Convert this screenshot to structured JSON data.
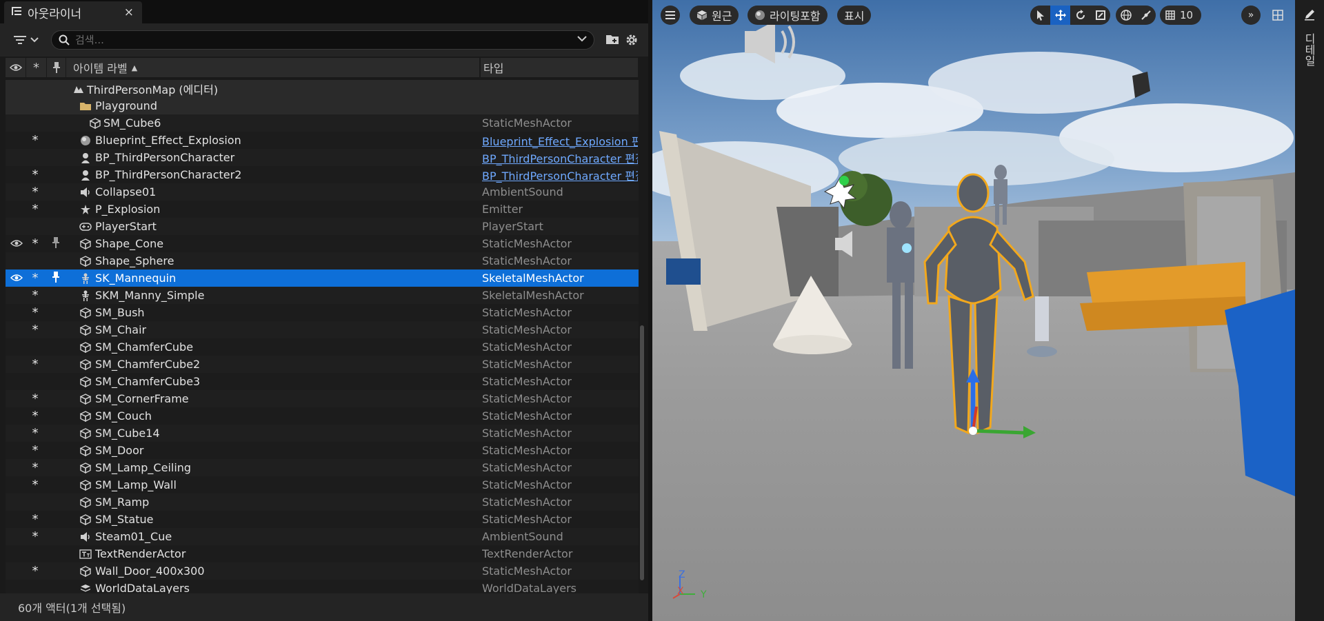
{
  "outliner": {
    "tab_title": "아웃라이너",
    "close": "×",
    "search_placeholder": "검색...",
    "columns": {
      "label": "아이템 라벨",
      "sort": "▲",
      "type": "타입"
    },
    "status": "60개 액터(1개 선택됨)"
  },
  "rows": [
    {
      "name": "ThirdPersonMap (에디터)",
      "type": "",
      "icon": "map-icon",
      "star": false,
      "eye": false,
      "pin": false,
      "kind": "level"
    },
    {
      "name": "Playground",
      "type": "",
      "icon": "folder-icon",
      "star": false,
      "eye": false,
      "pin": false,
      "kind": "folder"
    },
    {
      "name": "SM_Cube6",
      "type": "StaticMeshActor",
      "icon": "cube-icon",
      "star": false,
      "eye": false,
      "pin": false,
      "kind": "child"
    },
    {
      "name": "Blueprint_Effect_Explosion",
      "type": "Blueprint_Effect_Explosion 편집",
      "icon": "blueprint-icon",
      "star": true,
      "eye": false,
      "pin": false,
      "kind": "item",
      "link": true
    },
    {
      "name": "BP_ThirdPersonCharacter",
      "type": "BP_ThirdPersonCharacter 편집",
      "icon": "character-icon",
      "star": false,
      "eye": false,
      "pin": false,
      "kind": "item",
      "link": true
    },
    {
      "name": "BP_ThirdPersonCharacter2",
      "type": "BP_ThirdPersonCharacter 편집",
      "icon": "character-icon",
      "star": true,
      "eye": false,
      "pin": false,
      "kind": "item",
      "link": true
    },
    {
      "name": "Collapse01",
      "type": "AmbientSound",
      "icon": "speaker-icon",
      "star": true,
      "eye": false,
      "pin": false,
      "kind": "item"
    },
    {
      "name": "P_Explosion",
      "type": "Emitter",
      "icon": "emitter-icon",
      "star": true,
      "eye": false,
      "pin": false,
      "kind": "item"
    },
    {
      "name": "PlayerStart",
      "type": "PlayerStart",
      "icon": "gamepad-icon",
      "star": false,
      "eye": false,
      "pin": false,
      "kind": "item"
    },
    {
      "name": "Shape_Cone",
      "type": "StaticMeshActor",
      "icon": "cube-icon",
      "star": true,
      "eye": true,
      "pin": true,
      "kind": "item"
    },
    {
      "name": "Shape_Sphere",
      "type": "StaticMeshActor",
      "icon": "cube-icon",
      "star": false,
      "eye": false,
      "pin": false,
      "kind": "item"
    },
    {
      "name": "SK_Mannequin",
      "type": "SkeletalMeshActor",
      "icon": "skeleton-icon",
      "star": true,
      "eye": true,
      "pin": true,
      "kind": "item",
      "selected": true
    },
    {
      "name": "SKM_Manny_Simple",
      "type": "SkeletalMeshActor",
      "icon": "skeleton-icon",
      "star": true,
      "eye": false,
      "pin": false,
      "kind": "item"
    },
    {
      "name": "SM_Bush",
      "type": "StaticMeshActor",
      "icon": "cube-icon",
      "star": true,
      "eye": false,
      "pin": false,
      "kind": "item"
    },
    {
      "name": "SM_Chair",
      "type": "StaticMeshActor",
      "icon": "cube-icon",
      "star": true,
      "eye": false,
      "pin": false,
      "kind": "item"
    },
    {
      "name": "SM_ChamferCube",
      "type": "StaticMeshActor",
      "icon": "cube-icon",
      "star": false,
      "eye": false,
      "pin": false,
      "kind": "item"
    },
    {
      "name": "SM_ChamferCube2",
      "type": "StaticMeshActor",
      "icon": "cube-icon",
      "star": true,
      "eye": false,
      "pin": false,
      "kind": "item"
    },
    {
      "name": "SM_ChamferCube3",
      "type": "StaticMeshActor",
      "icon": "cube-icon",
      "star": false,
      "eye": false,
      "pin": false,
      "kind": "item"
    },
    {
      "name": "SM_CornerFrame",
      "type": "StaticMeshActor",
      "icon": "cube-icon",
      "star": true,
      "eye": false,
      "pin": false,
      "kind": "item"
    },
    {
      "name": "SM_Couch",
      "type": "StaticMeshActor",
      "icon": "cube-icon",
      "star": true,
      "eye": false,
      "pin": false,
      "kind": "item"
    },
    {
      "name": "SM_Cube14",
      "type": "StaticMeshActor",
      "icon": "cube-icon",
      "star": true,
      "eye": false,
      "pin": false,
      "kind": "item"
    },
    {
      "name": "SM_Door",
      "type": "StaticMeshActor",
      "icon": "cube-icon",
      "star": true,
      "eye": false,
      "pin": false,
      "kind": "item"
    },
    {
      "name": "SM_Lamp_Ceiling",
      "type": "StaticMeshActor",
      "icon": "cube-icon",
      "star": true,
      "eye": false,
      "pin": false,
      "kind": "item"
    },
    {
      "name": "SM_Lamp_Wall",
      "type": "StaticMeshActor",
      "icon": "cube-icon",
      "star": true,
      "eye": false,
      "pin": false,
      "kind": "item"
    },
    {
      "name": "SM_Ramp",
      "type": "StaticMeshActor",
      "icon": "cube-icon",
      "star": false,
      "eye": false,
      "pin": false,
      "kind": "item"
    },
    {
      "name": "SM_Statue",
      "type": "StaticMeshActor",
      "icon": "cube-icon",
      "star": true,
      "eye": false,
      "pin": false,
      "kind": "item"
    },
    {
      "name": "Steam01_Cue",
      "type": "AmbientSound",
      "icon": "speaker-icon",
      "star": true,
      "eye": false,
      "pin": false,
      "kind": "item"
    },
    {
      "name": "TextRenderActor",
      "type": "TextRenderActor",
      "icon": "text-icon",
      "star": false,
      "eye": false,
      "pin": false,
      "kind": "item"
    },
    {
      "name": "Wall_Door_400x300",
      "type": "StaticMeshActor",
      "icon": "cube-icon",
      "star": true,
      "eye": false,
      "pin": false,
      "kind": "item"
    },
    {
      "name": "WorldDataLayers",
      "type": "WorldDataLayers",
      "icon": "layers-icon",
      "star": false,
      "eye": false,
      "pin": false,
      "kind": "item"
    }
  ],
  "viewport": {
    "perspective": "원근",
    "lighting": "라이팅포함",
    "show": "표시",
    "grid_snap": "10",
    "axis_z": "Z",
    "axis_x": "X",
    "axis_y": "Y"
  },
  "right_panel": {
    "details": "디테일"
  },
  "colors": {
    "selected": "#0e6fd8",
    "link": "#6fa9ff",
    "accent": "#1a62c2",
    "outline": "#f2a81d"
  }
}
